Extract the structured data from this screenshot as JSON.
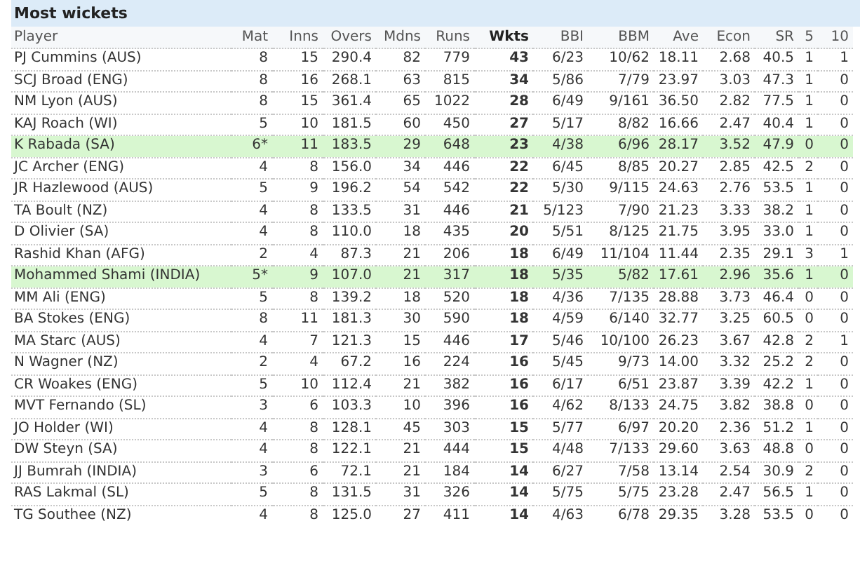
{
  "title": "Most wickets",
  "columns": [
    {
      "label": "Player",
      "bold": false
    },
    {
      "label": "Mat",
      "bold": false
    },
    {
      "label": "Inns",
      "bold": false
    },
    {
      "label": "Overs",
      "bold": false
    },
    {
      "label": "Mdns",
      "bold": false
    },
    {
      "label": "Runs",
      "bold": false
    },
    {
      "label": "Wkts",
      "bold": true
    },
    {
      "label": "BBI",
      "bold": false
    },
    {
      "label": "BBM",
      "bold": false
    },
    {
      "label": "Ave",
      "bold": false
    },
    {
      "label": "Econ",
      "bold": false
    },
    {
      "label": "SR",
      "bold": false
    },
    {
      "label": "5",
      "bold": false
    },
    {
      "label": "10",
      "bold": false
    }
  ],
  "rows": [
    {
      "highlighted": false,
      "cells": [
        "PJ Cummins (AUS)",
        "8",
        "15",
        "290.4",
        "82",
        "779",
        "43",
        "6/23",
        "10/62",
        "18.11",
        "2.68",
        "40.5",
        "1",
        "1"
      ]
    },
    {
      "highlighted": false,
      "cells": [
        "SCJ Broad (ENG)",
        "8",
        "16",
        "268.1",
        "63",
        "815",
        "34",
        "5/86",
        "7/79",
        "23.97",
        "3.03",
        "47.3",
        "1",
        "0"
      ]
    },
    {
      "highlighted": false,
      "cells": [
        "NM Lyon (AUS)",
        "8",
        "15",
        "361.4",
        "65",
        "1022",
        "28",
        "6/49",
        "9/161",
        "36.50",
        "2.82",
        "77.5",
        "1",
        "0"
      ]
    },
    {
      "highlighted": false,
      "cells": [
        "KAJ Roach (WI)",
        "5",
        "10",
        "181.5",
        "60",
        "450",
        "27",
        "5/17",
        "8/82",
        "16.66",
        "2.47",
        "40.4",
        "1",
        "0"
      ]
    },
    {
      "highlighted": true,
      "cells": [
        "K Rabada (SA)",
        "6*",
        "11",
        "183.5",
        "29",
        "648",
        "23",
        "4/38",
        "6/96",
        "28.17",
        "3.52",
        "47.9",
        "0",
        "0"
      ]
    },
    {
      "highlighted": false,
      "cells": [
        "JC Archer (ENG)",
        "4",
        "8",
        "156.0",
        "34",
        "446",
        "22",
        "6/45",
        "8/85",
        "20.27",
        "2.85",
        "42.5",
        "2",
        "0"
      ]
    },
    {
      "highlighted": false,
      "cells": [
        "JR Hazlewood (AUS)",
        "5",
        "9",
        "196.2",
        "54",
        "542",
        "22",
        "5/30",
        "9/115",
        "24.63",
        "2.76",
        "53.5",
        "1",
        "0"
      ]
    },
    {
      "highlighted": false,
      "cells": [
        "TA Boult (NZ)",
        "4",
        "8",
        "133.5",
        "31",
        "446",
        "21",
        "5/123",
        "7/90",
        "21.23",
        "3.33",
        "38.2",
        "1",
        "0"
      ]
    },
    {
      "highlighted": false,
      "cells": [
        "D Olivier (SA)",
        "4",
        "8",
        "110.0",
        "18",
        "435",
        "20",
        "5/51",
        "8/125",
        "21.75",
        "3.95",
        "33.0",
        "1",
        "0"
      ]
    },
    {
      "highlighted": false,
      "cells": [
        "Rashid Khan (AFG)",
        "2",
        "4",
        "87.3",
        "21",
        "206",
        "18",
        "6/49",
        "11/104",
        "11.44",
        "2.35",
        "29.1",
        "3",
        "1"
      ]
    },
    {
      "highlighted": true,
      "cells": [
        "Mohammed Shami (INDIA)",
        "5*",
        "9",
        "107.0",
        "21",
        "317",
        "18",
        "5/35",
        "5/82",
        "17.61",
        "2.96",
        "35.6",
        "1",
        "0"
      ]
    },
    {
      "highlighted": false,
      "cells": [
        "MM Ali (ENG)",
        "5",
        "8",
        "139.2",
        "18",
        "520",
        "18",
        "4/36",
        "7/135",
        "28.88",
        "3.73",
        "46.4",
        "0",
        "0"
      ]
    },
    {
      "highlighted": false,
      "cells": [
        "BA Stokes (ENG)",
        "8",
        "11",
        "181.3",
        "30",
        "590",
        "18",
        "4/59",
        "6/140",
        "32.77",
        "3.25",
        "60.5",
        "0",
        "0"
      ]
    },
    {
      "highlighted": false,
      "cells": [
        "MA Starc (AUS)",
        "4",
        "7",
        "121.3",
        "15",
        "446",
        "17",
        "5/46",
        "10/100",
        "26.23",
        "3.67",
        "42.8",
        "2",
        "1"
      ]
    },
    {
      "highlighted": false,
      "cells": [
        "N Wagner (NZ)",
        "2",
        "4",
        "67.2",
        "16",
        "224",
        "16",
        "5/45",
        "9/73",
        "14.00",
        "3.32",
        "25.2",
        "2",
        "0"
      ]
    },
    {
      "highlighted": false,
      "cells": [
        "CR Woakes (ENG)",
        "5",
        "10",
        "112.4",
        "21",
        "382",
        "16",
        "6/17",
        "6/51",
        "23.87",
        "3.39",
        "42.2",
        "1",
        "0"
      ]
    },
    {
      "highlighted": false,
      "cells": [
        "MVT Fernando (SL)",
        "3",
        "6",
        "103.3",
        "10",
        "396",
        "16",
        "4/62",
        "8/133",
        "24.75",
        "3.82",
        "38.8",
        "0",
        "0"
      ]
    },
    {
      "highlighted": false,
      "cells": [
        "JO Holder (WI)",
        "4",
        "8",
        "128.1",
        "45",
        "303",
        "15",
        "5/77",
        "6/97",
        "20.20",
        "2.36",
        "51.2",
        "1",
        "0"
      ]
    },
    {
      "highlighted": false,
      "cells": [
        "DW Steyn (SA)",
        "4",
        "8",
        "122.1",
        "21",
        "444",
        "15",
        "4/48",
        "7/133",
        "29.60",
        "3.63",
        "48.8",
        "0",
        "0"
      ]
    },
    {
      "highlighted": false,
      "cells": [
        "JJ Bumrah (INDIA)",
        "3",
        "6",
        "72.1",
        "21",
        "184",
        "14",
        "6/27",
        "7/58",
        "13.14",
        "2.54",
        "30.9",
        "2",
        "0"
      ]
    },
    {
      "highlighted": false,
      "cells": [
        "RAS Lakmal (SL)",
        "5",
        "8",
        "131.5",
        "31",
        "326",
        "14",
        "5/75",
        "5/75",
        "23.28",
        "2.47",
        "56.5",
        "1",
        "0"
      ]
    },
    {
      "highlighted": false,
      "cells": [
        "TG Southee (NZ)",
        "4",
        "8",
        "125.0",
        "27",
        "411",
        "14",
        "4/63",
        "6/78",
        "29.35",
        "3.28",
        "53.5",
        "0",
        "0"
      ]
    }
  ]
}
